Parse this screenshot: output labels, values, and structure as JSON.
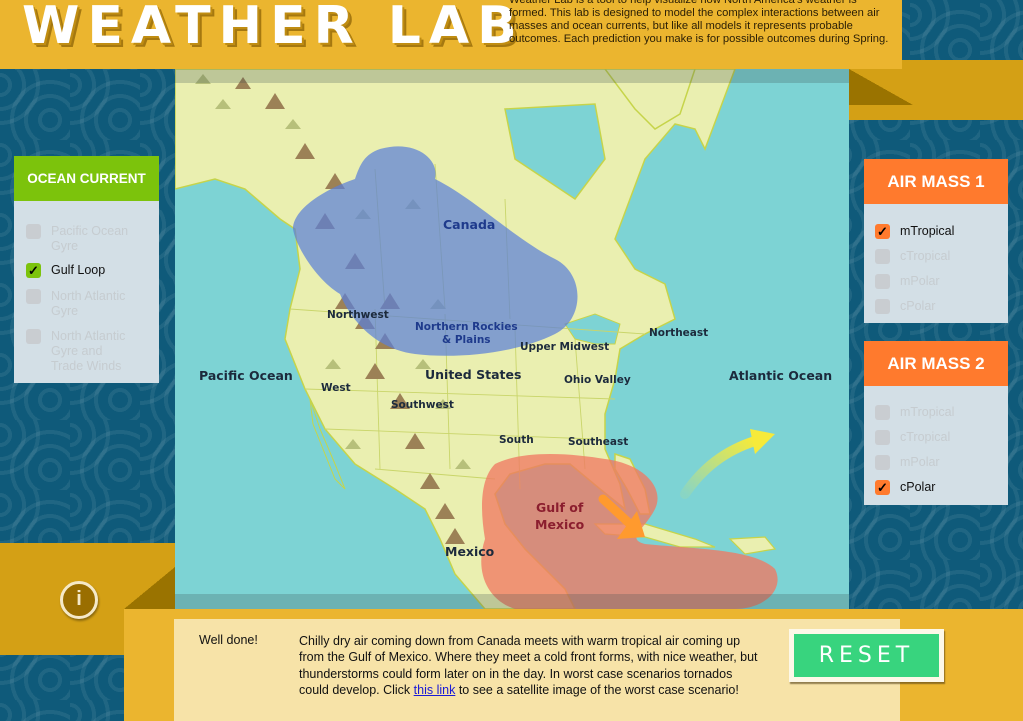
{
  "header": {
    "title": "WEATHER LAB",
    "intro": "Weather Lab is a tool to help visualize how North America's weather is formed. This lab is designed to model the complex interactions between air masses and ocean currents, but like all models it represents probable outcomes. Each prediction you make is for possible outcomes during Spring."
  },
  "map": {
    "labels": {
      "pacific": "Pacific Ocean",
      "atlantic": "Atlantic Ocean",
      "canada": "Canada",
      "us": "United States",
      "mexico": "Mexico",
      "gulf_line1": "Gulf of",
      "gulf_line2": "Mexico",
      "northwest": "Northwest",
      "nrockies_line1": "Northern Rockies",
      "nrockies_line2": "& Plains",
      "upper_midwest": "Upper Midwest",
      "northeast": "Northeast",
      "ohio_valley": "Ohio Valley",
      "west": "West",
      "southwest": "Southwest",
      "south": "South",
      "southeast": "Southeast"
    },
    "colors": {
      "ocean": "#7dd3d4",
      "land": "#eaefb0",
      "cold_air_mass": "#5b7fd8",
      "warm_air_mass": "#ef7a63",
      "jet_arrow": "#f6ea3a",
      "current_arrow": "#ff9a2e"
    }
  },
  "ocean_current": {
    "title": "OCEAN CURRENT",
    "options": [
      {
        "label": "Pacific Ocean Gyre",
        "checked": false,
        "enabled": false
      },
      {
        "label": "Gulf Loop",
        "checked": true,
        "enabled": true
      },
      {
        "label": "North Atlantic Gyre",
        "checked": false,
        "enabled": false
      },
      {
        "label": "North Atlantic Gyre and Trade Winds",
        "checked": false,
        "enabled": false
      }
    ]
  },
  "air_mass_1": {
    "title": "AIR MASS 1",
    "options": [
      {
        "label": "mTropical",
        "checked": true,
        "enabled": true
      },
      {
        "label": "cTropical",
        "checked": false,
        "enabled": false
      },
      {
        "label": "mPolar",
        "checked": false,
        "enabled": false
      },
      {
        "label": "cPolar",
        "checked": false,
        "enabled": false
      }
    ]
  },
  "air_mass_2": {
    "title": "AIR MASS 2",
    "options": [
      {
        "label": "mTropical",
        "checked": false,
        "enabled": false
      },
      {
        "label": "cTropical",
        "checked": false,
        "enabled": false
      },
      {
        "label": "mPolar",
        "checked": false,
        "enabled": false
      },
      {
        "label": "cPolar",
        "checked": true,
        "enabled": true
      }
    ]
  },
  "result": {
    "heading": "Well done!",
    "message_before": "Chilly dry air coming down from Canada meets with warm tropical air coming up from the Gulf of Mexico. Where they meet a cold front forms, with nice weather, but thunderstorms could form later on in the day. In worst case scenarios tornados could develop. Click ",
    "link_text": "this link",
    "message_after": " to see a satellite image of the worst case scenario!"
  },
  "buttons": {
    "reset": "RESET",
    "info_glyph": "i",
    "check_glyph": "✓"
  }
}
